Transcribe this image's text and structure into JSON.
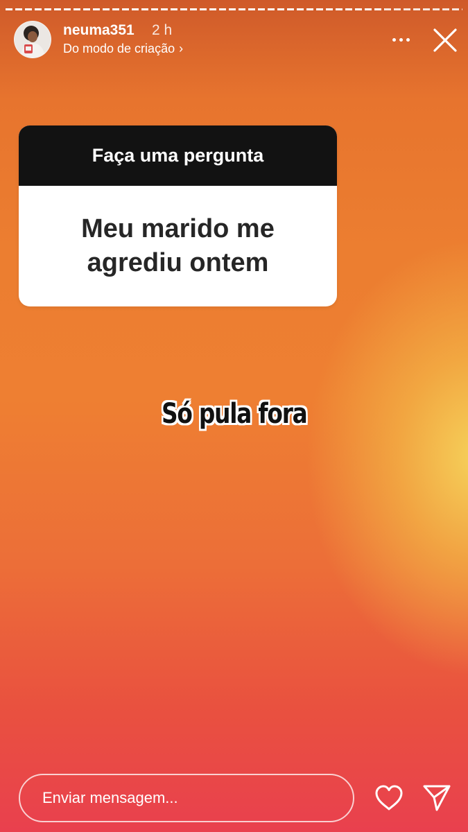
{
  "story": {
    "progress_fraction": 0.83,
    "username": "neuma351",
    "time": "2 h",
    "subtitle": "Do modo de criação",
    "subtitle_chevron": "›"
  },
  "question_sticker": {
    "header": "Faça uma pergunta",
    "question": "Meu marido me agrediu ontem"
  },
  "caption": "Só pula fora",
  "footer": {
    "message_placeholder": "Enviar mensagem..."
  },
  "icons": {
    "more": "more-horizontal-icon",
    "close": "close-icon",
    "like": "heart-icon",
    "send": "paper-plane-icon"
  },
  "colors": {
    "background_top": "#cf5a2a",
    "background_mid": "#ee7f32",
    "background_bottom": "#e9404e",
    "glow": "#f6d65c",
    "sticker_header_bg": "#121212",
    "sticker_body_bg": "#ffffff"
  }
}
